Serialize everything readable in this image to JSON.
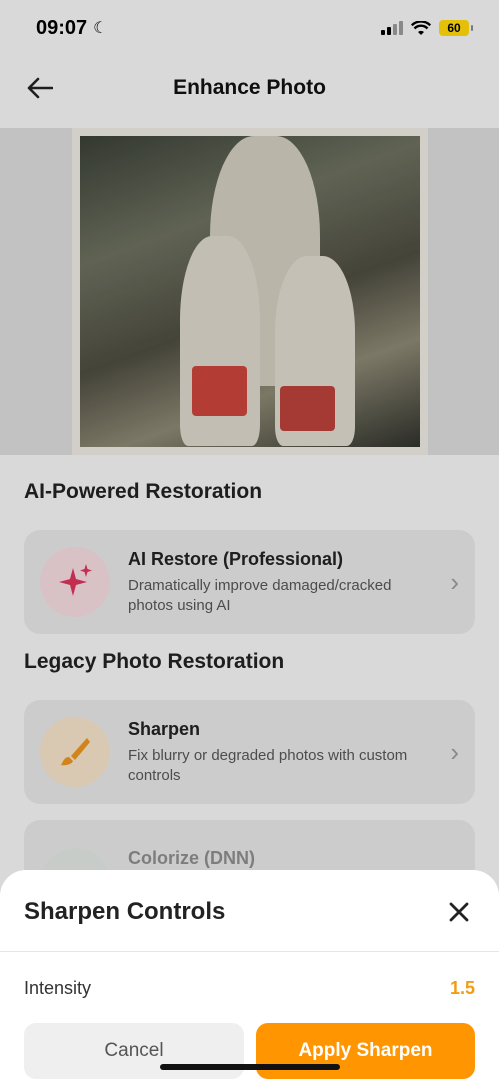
{
  "status_bar": {
    "time": "09:07",
    "battery": "60"
  },
  "header": {
    "title": "Enhance Photo"
  },
  "sections": {
    "ai_title": "AI-Powered Restoration",
    "legacy_title": "Legacy Photo Restoration"
  },
  "cards": {
    "ai_restore": {
      "title": "AI Restore (Professional)",
      "desc": "Dramatically improve damaged/cracked photos using AI"
    },
    "sharpen": {
      "title": "Sharpen",
      "desc": "Fix blurry or degraded photos with custom controls"
    },
    "colorize": {
      "title": "Colorize (DNN)"
    }
  },
  "sheet": {
    "title": "Sharpen Controls",
    "intensity_label": "Intensity",
    "intensity_value": "1.5",
    "cancel_label": "Cancel",
    "apply_label": "Apply Sharpen"
  },
  "colors": {
    "accent": "#ff9500",
    "value": "#f39c12",
    "sparkle": "#d9345a"
  },
  "icons": {
    "back": "arrow-left-icon",
    "sparkle": "sparkles-icon",
    "brush": "brush-icon",
    "close": "close-icon",
    "chevron": "chevron-right-icon"
  }
}
